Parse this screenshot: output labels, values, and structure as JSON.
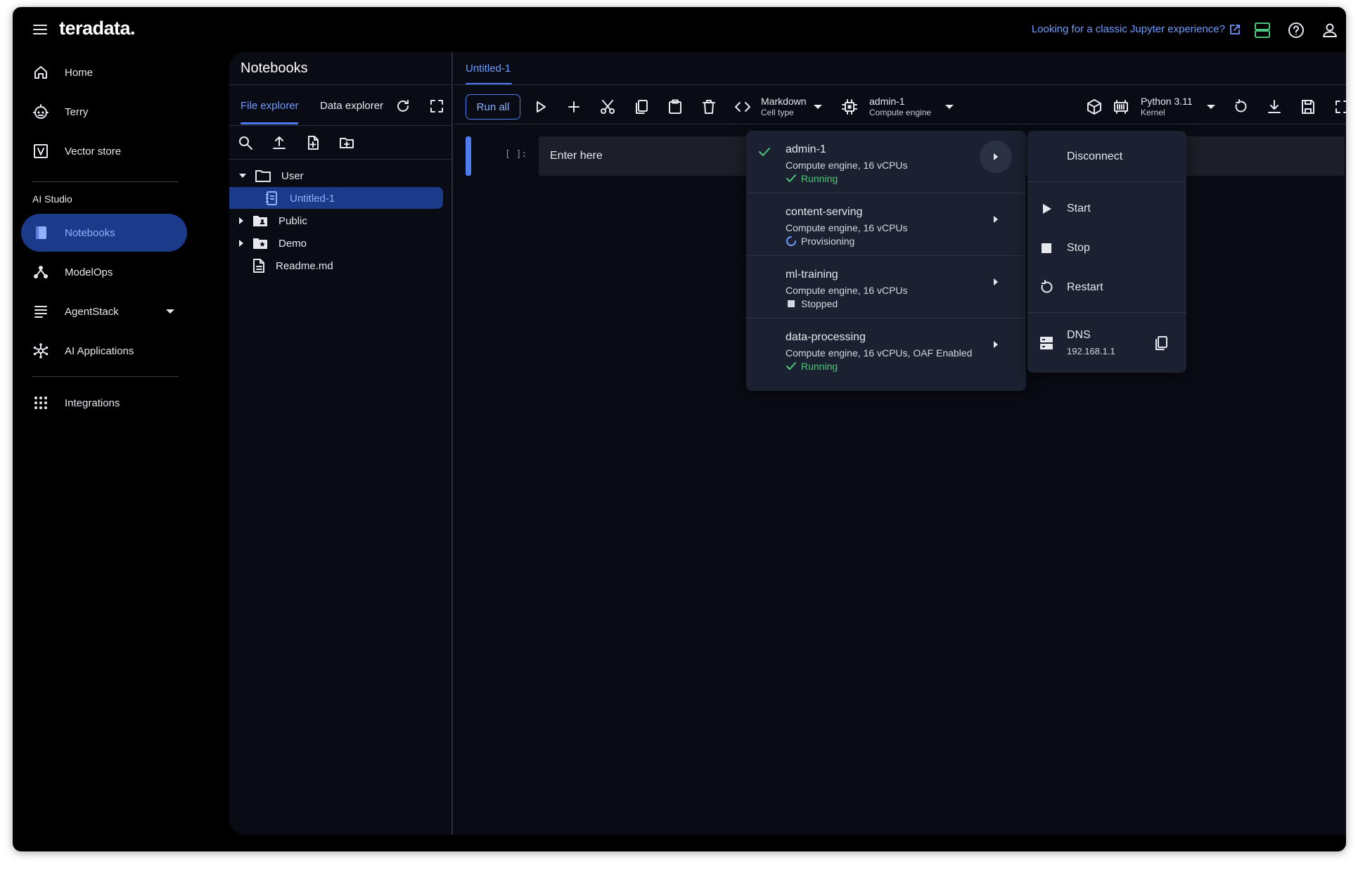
{
  "app": {
    "logo": "teradata.",
    "classic_link": "Looking for a classic Jupyter experience?",
    "accent": "#4f7cf0",
    "success": "#4cc67a"
  },
  "sidebar": {
    "items": [
      {
        "label": "Home",
        "icon": "home-icon"
      },
      {
        "label": "Terry",
        "icon": "robot-icon"
      },
      {
        "label": "Vector store",
        "icon": "vector-store-icon"
      }
    ],
    "section_label": "AI Studio",
    "studio_items": [
      {
        "label": "Notebooks",
        "icon": "notebook-icon",
        "active": true
      },
      {
        "label": "ModelOps",
        "icon": "modelops-icon"
      },
      {
        "label": "AgentStack",
        "icon": "agentstack-icon"
      },
      {
        "label": "AI Applications",
        "icon": "ai-applications-icon"
      }
    ],
    "bottom_items": [
      {
        "label": "Integrations",
        "icon": "grid-icon"
      }
    ]
  },
  "notebooks": {
    "title": "Notebooks",
    "tabs": [
      {
        "label": "File explorer",
        "active": true
      },
      {
        "label": "Data explorer",
        "active": false
      }
    ],
    "tree": [
      {
        "label": "User",
        "type": "folder",
        "expanded": true
      },
      {
        "label": "Untitled-1",
        "type": "notebook",
        "selected": true
      },
      {
        "label": "Public",
        "type": "folder-shared"
      },
      {
        "label": "Demo",
        "type": "folder-star"
      },
      {
        "label": "Readme.md",
        "type": "file"
      }
    ]
  },
  "editor": {
    "doc_tab": "Untitled-1",
    "run_all": "Run all",
    "cell_type": {
      "value": "Markdown",
      "label": "Cell type"
    },
    "compute_engine": {
      "value": "admin-1",
      "label": "Compute engine"
    },
    "kernel": {
      "value": "Python 3.11",
      "label": "Kernel"
    },
    "cell": {
      "prompt": "[ ]:",
      "placeholder": "Enter here"
    }
  },
  "engine_menu": {
    "items": [
      {
        "name": "admin-1",
        "desc": "Compute engine, 16 vCPUs",
        "status": "Running",
        "status_type": "running",
        "selected": true
      },
      {
        "name": "content-serving",
        "desc": "Compute engine, 16 vCPUs",
        "status": "Provisioning",
        "status_type": "provisioning"
      },
      {
        "name": "ml-training",
        "desc": "Compute engine, 16 vCPUs",
        "status": "Stopped",
        "status_type": "stopped"
      },
      {
        "name": "data-processing",
        "desc": "Compute engine, 16 vCPUs, OAF Enabled",
        "status": "Running",
        "status_type": "running"
      }
    ]
  },
  "action_menu": {
    "disconnect": "Disconnect",
    "start": "Start",
    "stop": "Stop",
    "restart": "Restart",
    "dns_label": "DNS",
    "dns_value": "192.168.1.1"
  }
}
